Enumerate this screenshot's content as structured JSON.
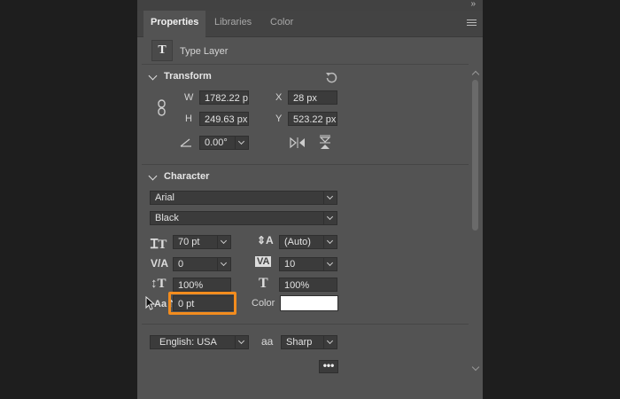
{
  "tabs": [
    {
      "label": "Properties",
      "active": true
    },
    {
      "label": "Libraries",
      "active": false
    },
    {
      "label": "Color",
      "active": false
    }
  ],
  "layer_type": "Type Layer",
  "type_icon": "T",
  "transform": {
    "title": "Transform",
    "w_label": "W",
    "w_value": "1782.22 p",
    "x_label": "X",
    "x_value": "28 px",
    "h_label": "H",
    "h_value": "249.63 px",
    "y_label": "Y",
    "y_value": "523.22 px",
    "angle_value": "0.00°"
  },
  "character": {
    "title": "Character",
    "font_family": "Arial",
    "font_style": "Black",
    "font_size": "70 pt",
    "leading": "(Auto)",
    "kerning": "0",
    "tracking": "10",
    "vertical_scale": "100%",
    "horizontal_scale": "100%",
    "baseline_shift": "0 pt",
    "color_label": "Color",
    "color_value": "#ffffff",
    "language": "English: USA",
    "antialias_icon": "aa",
    "antialias": "Sharp",
    "more_label": "•••"
  },
  "colors": {
    "panel_bg": "#535353",
    "field_bg": "#3b3b3b",
    "highlight": "#f28c1e"
  }
}
